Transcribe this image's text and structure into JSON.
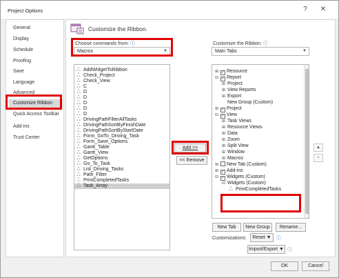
{
  "window": {
    "title": "Project Options",
    "help_glyph": "?",
    "close_glyph": "✕"
  },
  "nav": {
    "items": [
      {
        "label": "General"
      },
      {
        "label": "Display"
      },
      {
        "label": "Schedule"
      },
      {
        "label": "Proofing"
      },
      {
        "label": "Save"
      },
      {
        "label": "Language"
      },
      {
        "label": "Advanced"
      },
      {
        "label": "Customize Ribbon"
      },
      {
        "label": "Quick Access Toolbar"
      },
      {
        "label": "Add-ins"
      },
      {
        "label": "Trust Center"
      }
    ],
    "selected_index": 7
  },
  "header": {
    "title": "Customize the Ribbon."
  },
  "choose": {
    "label": "Choose commands from:",
    "info": "ⓘ",
    "value": "Macros"
  },
  "customize": {
    "label": "Customize the Ribbon:",
    "info": "ⓘ",
    "value": "Main Tabs"
  },
  "commands": [
    {
      "label": "AddWidgetToRibbon"
    },
    {
      "label": "Check_Project"
    },
    {
      "label": "Check_View"
    },
    {
      "label": "C"
    },
    {
      "label": "D"
    },
    {
      "label": "D"
    },
    {
      "label": "D"
    },
    {
      "label": "D"
    },
    {
      "label": "D"
    },
    {
      "label": "DrivingPathFilterAllTasks"
    },
    {
      "label": "DrivingPathSortByFinishDate"
    },
    {
      "label": "DrivingPathSortByStartDate"
    },
    {
      "label": "Form_GoTo_Driving_Task"
    },
    {
      "label": "Form_Save_Options"
    },
    {
      "label": "Gantt_Table"
    },
    {
      "label": "Gantt_View"
    },
    {
      "label": "GetOptions"
    },
    {
      "label": "Go_To_Task"
    },
    {
      "label": "List_Driving_Tasks"
    },
    {
      "label": "Path_Filter"
    },
    {
      "label": "PrintCompletedTasks"
    },
    {
      "label": "Task_Array"
    }
  ],
  "selected_command_index": 21,
  "tree": [
    {
      "label": "Resource",
      "indent": 0,
      "expander": "⊞",
      "check": true
    },
    {
      "label": "Report",
      "indent": 0,
      "expander": "⊟",
      "check": true
    },
    {
      "label": "Project",
      "indent": 1,
      "expander": "⊞",
      "check": null
    },
    {
      "label": "View Reports",
      "indent": 1,
      "expander": "⊞",
      "check": null
    },
    {
      "label": "Export",
      "indent": 1,
      "expander": "⊞",
      "check": null
    },
    {
      "label": "New Group (Custom)",
      "indent": 1,
      "expander": "",
      "check": null
    },
    {
      "label": "Project",
      "indent": 0,
      "expander": "⊞",
      "check": true
    },
    {
      "label": "View",
      "indent": 0,
      "expander": "⊟",
      "check": true
    },
    {
      "label": "Task Views",
      "indent": 1,
      "expander": "⊞",
      "check": null
    },
    {
      "label": "Resource Views",
      "indent": 1,
      "expander": "⊞",
      "check": null
    },
    {
      "label": "Data",
      "indent": 1,
      "expander": "⊞",
      "check": null
    },
    {
      "label": "Zoom",
      "indent": 1,
      "expander": "⊞",
      "check": null
    },
    {
      "label": "Split View",
      "indent": 1,
      "expander": "⊞",
      "check": null
    },
    {
      "label": "Window",
      "indent": 1,
      "expander": "⊞",
      "check": null
    },
    {
      "label": "Macros",
      "indent": 1,
      "expander": "⊞",
      "check": null
    },
    {
      "label": "New Tab (Custom)",
      "indent": 0,
      "expander": "⊞",
      "check": false
    },
    {
      "label": "Add-ins",
      "indent": 0,
      "expander": "⊞",
      "check": true
    },
    {
      "label": "Widgets (Custom)",
      "indent": 0,
      "expander": "⊟",
      "check": true
    },
    {
      "label": "Widgets (Custom)",
      "indent": 1,
      "expander": "⊟",
      "check": null
    },
    {
      "label": "PrintCompletedTasks",
      "indent": 2,
      "expander": "",
      "check": null
    }
  ],
  "buttons": {
    "add": "Add >>",
    "remove": "<< Remove",
    "new_tab": "New Tab",
    "new_group": "New Group",
    "rename": "Rename...",
    "customizations_label": "Customizations:",
    "reset": "Reset ▼",
    "import_export": "Import/Export ▼",
    "ok": "OK",
    "cancel": "Cancel"
  },
  "icons": {
    "macro_glyph": "ஃ",
    "up": "▲",
    "down": "▼"
  },
  "colors": {
    "highlight": "#e00000"
  }
}
